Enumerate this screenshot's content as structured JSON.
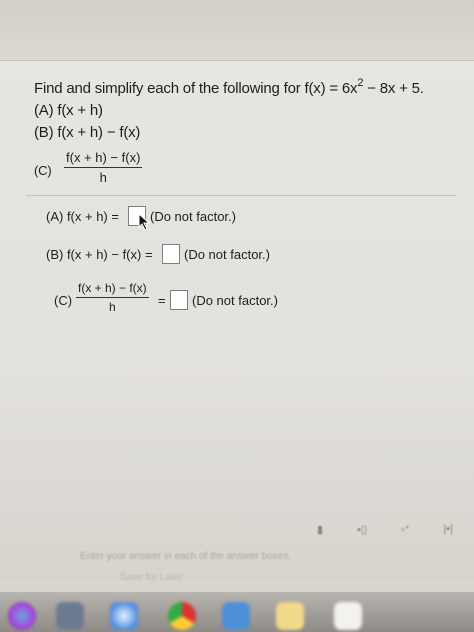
{
  "question": {
    "prompt_prefix": "Find and simplify each of the following for f(x) = 6x",
    "prompt_exponent": "2",
    "prompt_suffix": " − 8x + 5.",
    "part_a": "(A) f(x + h)",
    "part_b": "(B) f(x + h) − f(x)",
    "part_c_label": "(C)",
    "part_c_numerator": "f(x + h) − f(x)",
    "part_c_denominator": "h"
  },
  "answers": {
    "a_label": "(A) f(x + h) =",
    "a_hint": "(Do not factor.)",
    "b_label": "(B) f(x + h) − f(x) =",
    "b_hint": "(Do not factor.)",
    "c_label": "(C)",
    "c_numerator": "f(x + h) − f(x)",
    "c_denominator": "h",
    "c_equals": "=",
    "c_hint": "(Do not factor.)"
  },
  "footer": {
    "hint": "Enter your answer in each of the answer boxes.",
    "save_later": "Save for Later"
  },
  "icons": {
    "toolbar": [
      "fraction-icon",
      "mixed-number-icon",
      "exponent-icon",
      "absolute-value-icon"
    ],
    "dock": [
      "siri-icon",
      "launchpad-icon",
      "safari-icon",
      "chrome-icon",
      "folder-icon",
      "notes-icon",
      "calendar-icon"
    ]
  },
  "colors": {
    "panel": "#e5e3de",
    "text": "#1e1e1e"
  }
}
